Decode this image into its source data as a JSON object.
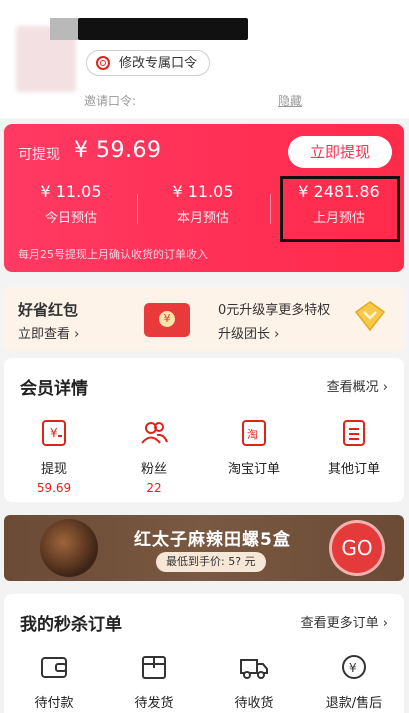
{
  "header": {
    "modify_code_label": "修改专属口令",
    "invite_code_label": "邀请口令:",
    "hide_label": "隐藏"
  },
  "earnings": {
    "withdrawable_label": "可提现",
    "withdrawable_amount": "¥ 59.69",
    "withdraw_now": "立即提现",
    "stats": [
      {
        "value": "¥ 11.05",
        "label": "今日预估"
      },
      {
        "value": "¥ 11.05",
        "label": "本月预估"
      },
      {
        "value": "¥ 2481.86",
        "label": "上月预估"
      }
    ],
    "note": "每月25号提现上月确认收货的订单收入"
  },
  "promo": {
    "left_title": "好省红包",
    "left_action": "立即查看",
    "right_title": "0元升级享更多特权",
    "right_action": "升级团长"
  },
  "member": {
    "title": "会员详情",
    "more": "查看概况",
    "items": [
      {
        "label": "提现",
        "value": "59.69",
        "icon": "withdraw-icon"
      },
      {
        "label": "粉丝",
        "value": "22",
        "icon": "fans-icon"
      },
      {
        "label": "淘宝订单",
        "icon": "taobao-order-icon"
      },
      {
        "label": "其他订单",
        "icon": "other-order-icon"
      }
    ]
  },
  "banner": {
    "title": "红太子麻辣田螺5盒",
    "price": "最低到手价: 5? 元",
    "go": "GO"
  },
  "flash": {
    "title": "我的秒杀订单",
    "more": "查看更多订单",
    "items": [
      {
        "label": "待付款",
        "icon": "wallet-icon"
      },
      {
        "label": "待发货",
        "icon": "package-icon"
      },
      {
        "label": "待收货",
        "icon": "truck-icon"
      },
      {
        "label": "退款/售后",
        "icon": "refund-icon"
      }
    ]
  },
  "colors": {
    "accent": "#ff2f55",
    "highlight_border": "#111111"
  }
}
